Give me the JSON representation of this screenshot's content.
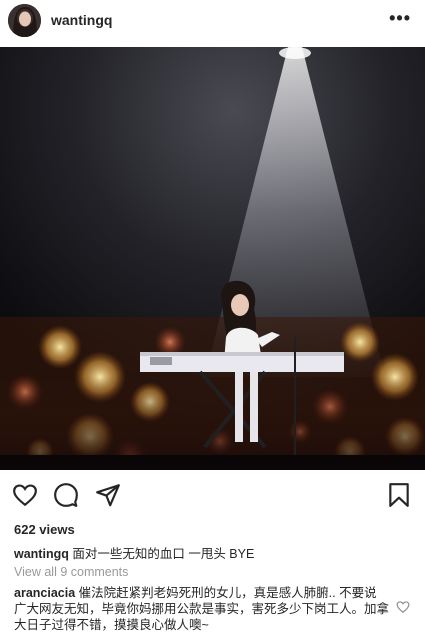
{
  "post": {
    "username": "wantingq",
    "more_icon": "more-dots-icon",
    "views": "622 views",
    "caption": {
      "username": "wantingq",
      "text": "面对一些无知的血口 一甩头 BYE"
    },
    "view_all_comments": "View all 9 comments",
    "comment": {
      "username": "aranciacia",
      "text": "催法院赶紧判老妈死刑的女儿，真是感人肺腑.. 不要说广大网友无知，毕竟你妈挪用公款是事实，害死多少下岗工人。加拿大日子过得不错，摸摸良心做人噢~"
    }
  },
  "icons": {
    "like": "heart-icon",
    "comment": "comment-bubble-icon",
    "share": "share-arrow-icon",
    "save": "bookmark-icon",
    "comment_like": "heart-outline-icon"
  },
  "colors": {
    "text": "#262626",
    "secondary": "#999999",
    "background": "#ffffff"
  }
}
